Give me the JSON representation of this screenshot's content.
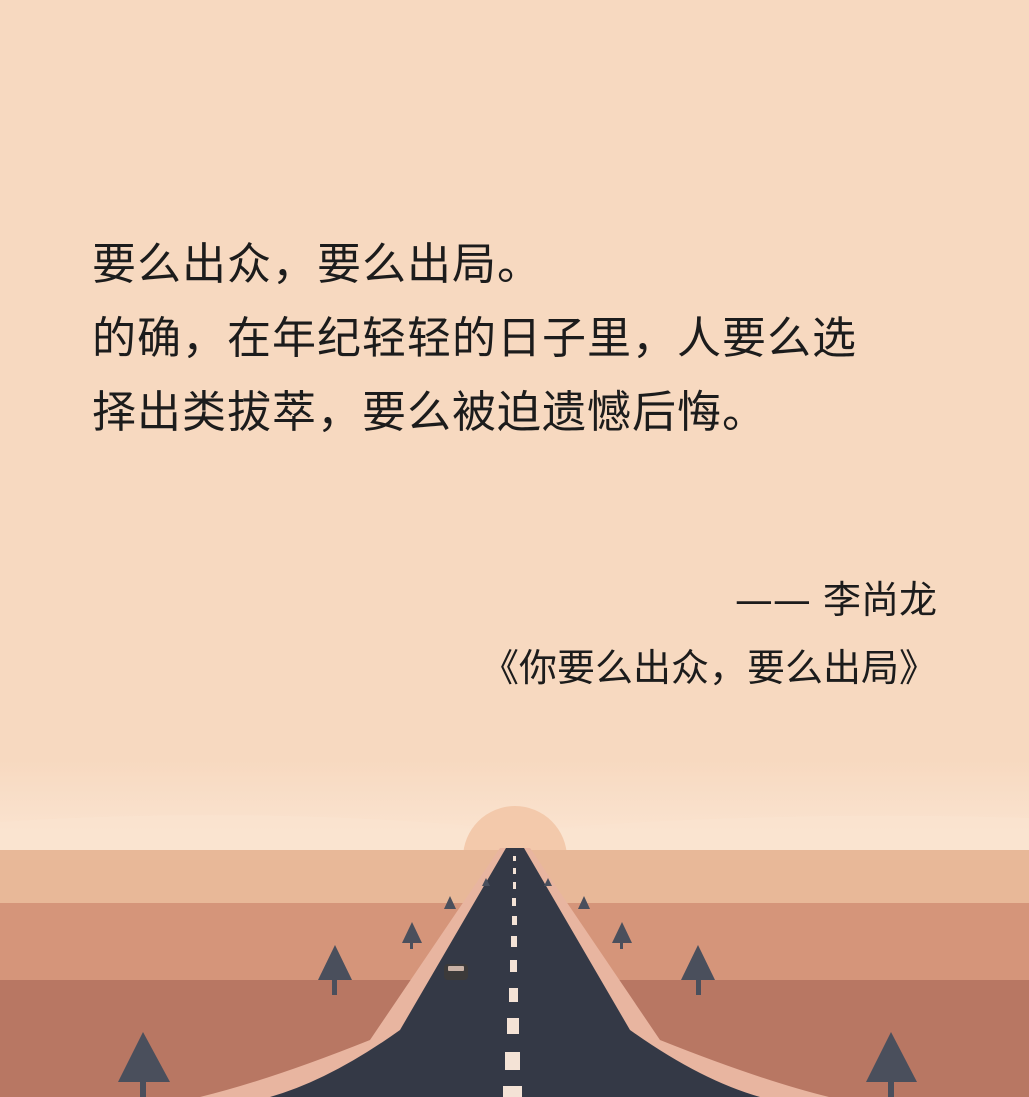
{
  "quote": {
    "lines": [
      "要么出众，要么出局。",
      "的确，在年纪轻轻的日子里，人要么选",
      "择出类拔萃，要么被迫遗憾后悔。"
    ]
  },
  "attribution": {
    "author": "—— 李尚龙",
    "source": "《你要么出众，要么出局》"
  },
  "colors": {
    "background": "#f7d9c0",
    "text": "#1c1c1c",
    "road": "#343946",
    "field_far": "#e8b898",
    "field_mid": "#d5957a",
    "field_near": "#b87763",
    "tree": "#4a4f5c"
  },
  "scene": {
    "icons": [
      "sun-icon",
      "road-icon",
      "car-icon",
      "tree-icon"
    ]
  }
}
